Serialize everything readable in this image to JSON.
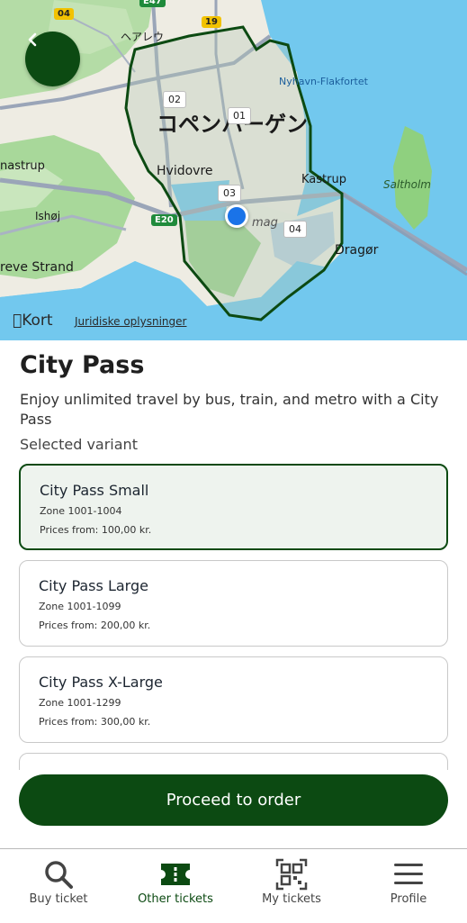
{
  "map": {
    "labels": {
      "city": "コペンハーゲン",
      "arelu": "ヘアレウ",
      "hvidovre": "Hvidovre",
      "kastrup": "Kastrup",
      "saltholm": "Saltholm",
      "ishoj": "Ishøj",
      "strand": "reve Strand",
      "nastrup": "nastrup",
      "dragor": "Dragør",
      "amager": "mag",
      "nyhavn": "Nyhavn-Flakfortet"
    },
    "zones": [
      "01",
      "02",
      "03",
      "04"
    ],
    "shields": [
      "04",
      "19",
      "E20",
      "E47"
    ],
    "attribution": "Kort",
    "legal": "Juridiske oplysninger",
    "colors": {
      "water": "#72c8ee",
      "land": "#f3f1e8",
      "green": "#a8d89a",
      "zone_border": "#0c4a12"
    }
  },
  "product": {
    "title": "City Pass",
    "description": "Enjoy unlimited travel by bus, train, and metro with a City Pass",
    "selected_label": "Selected variant"
  },
  "variants": [
    {
      "name": "City Pass Small",
      "zone": "Zone 1001-1004",
      "price": "Prices from: 100,00 kr.",
      "selected": true
    },
    {
      "name": "City Pass Large",
      "zone": "Zone 1001-1099",
      "price": "Prices from: 200,00 kr.",
      "selected": false
    },
    {
      "name": "City Pass X-Large",
      "zone": "Zone 1001-1299",
      "price": "Prices from: 300,00 kr.",
      "selected": false
    }
  ],
  "actions": {
    "proceed": "Proceed to order"
  },
  "tabs": [
    {
      "label": "Buy ticket",
      "icon": "search-icon"
    },
    {
      "label": "Other tickets",
      "icon": "ticket-icon",
      "active": true
    },
    {
      "label": "My tickets",
      "icon": "qr-code-icon"
    },
    {
      "label": "Profile",
      "icon": "menu-icon"
    }
  ],
  "brand_color": "#0c4a12"
}
